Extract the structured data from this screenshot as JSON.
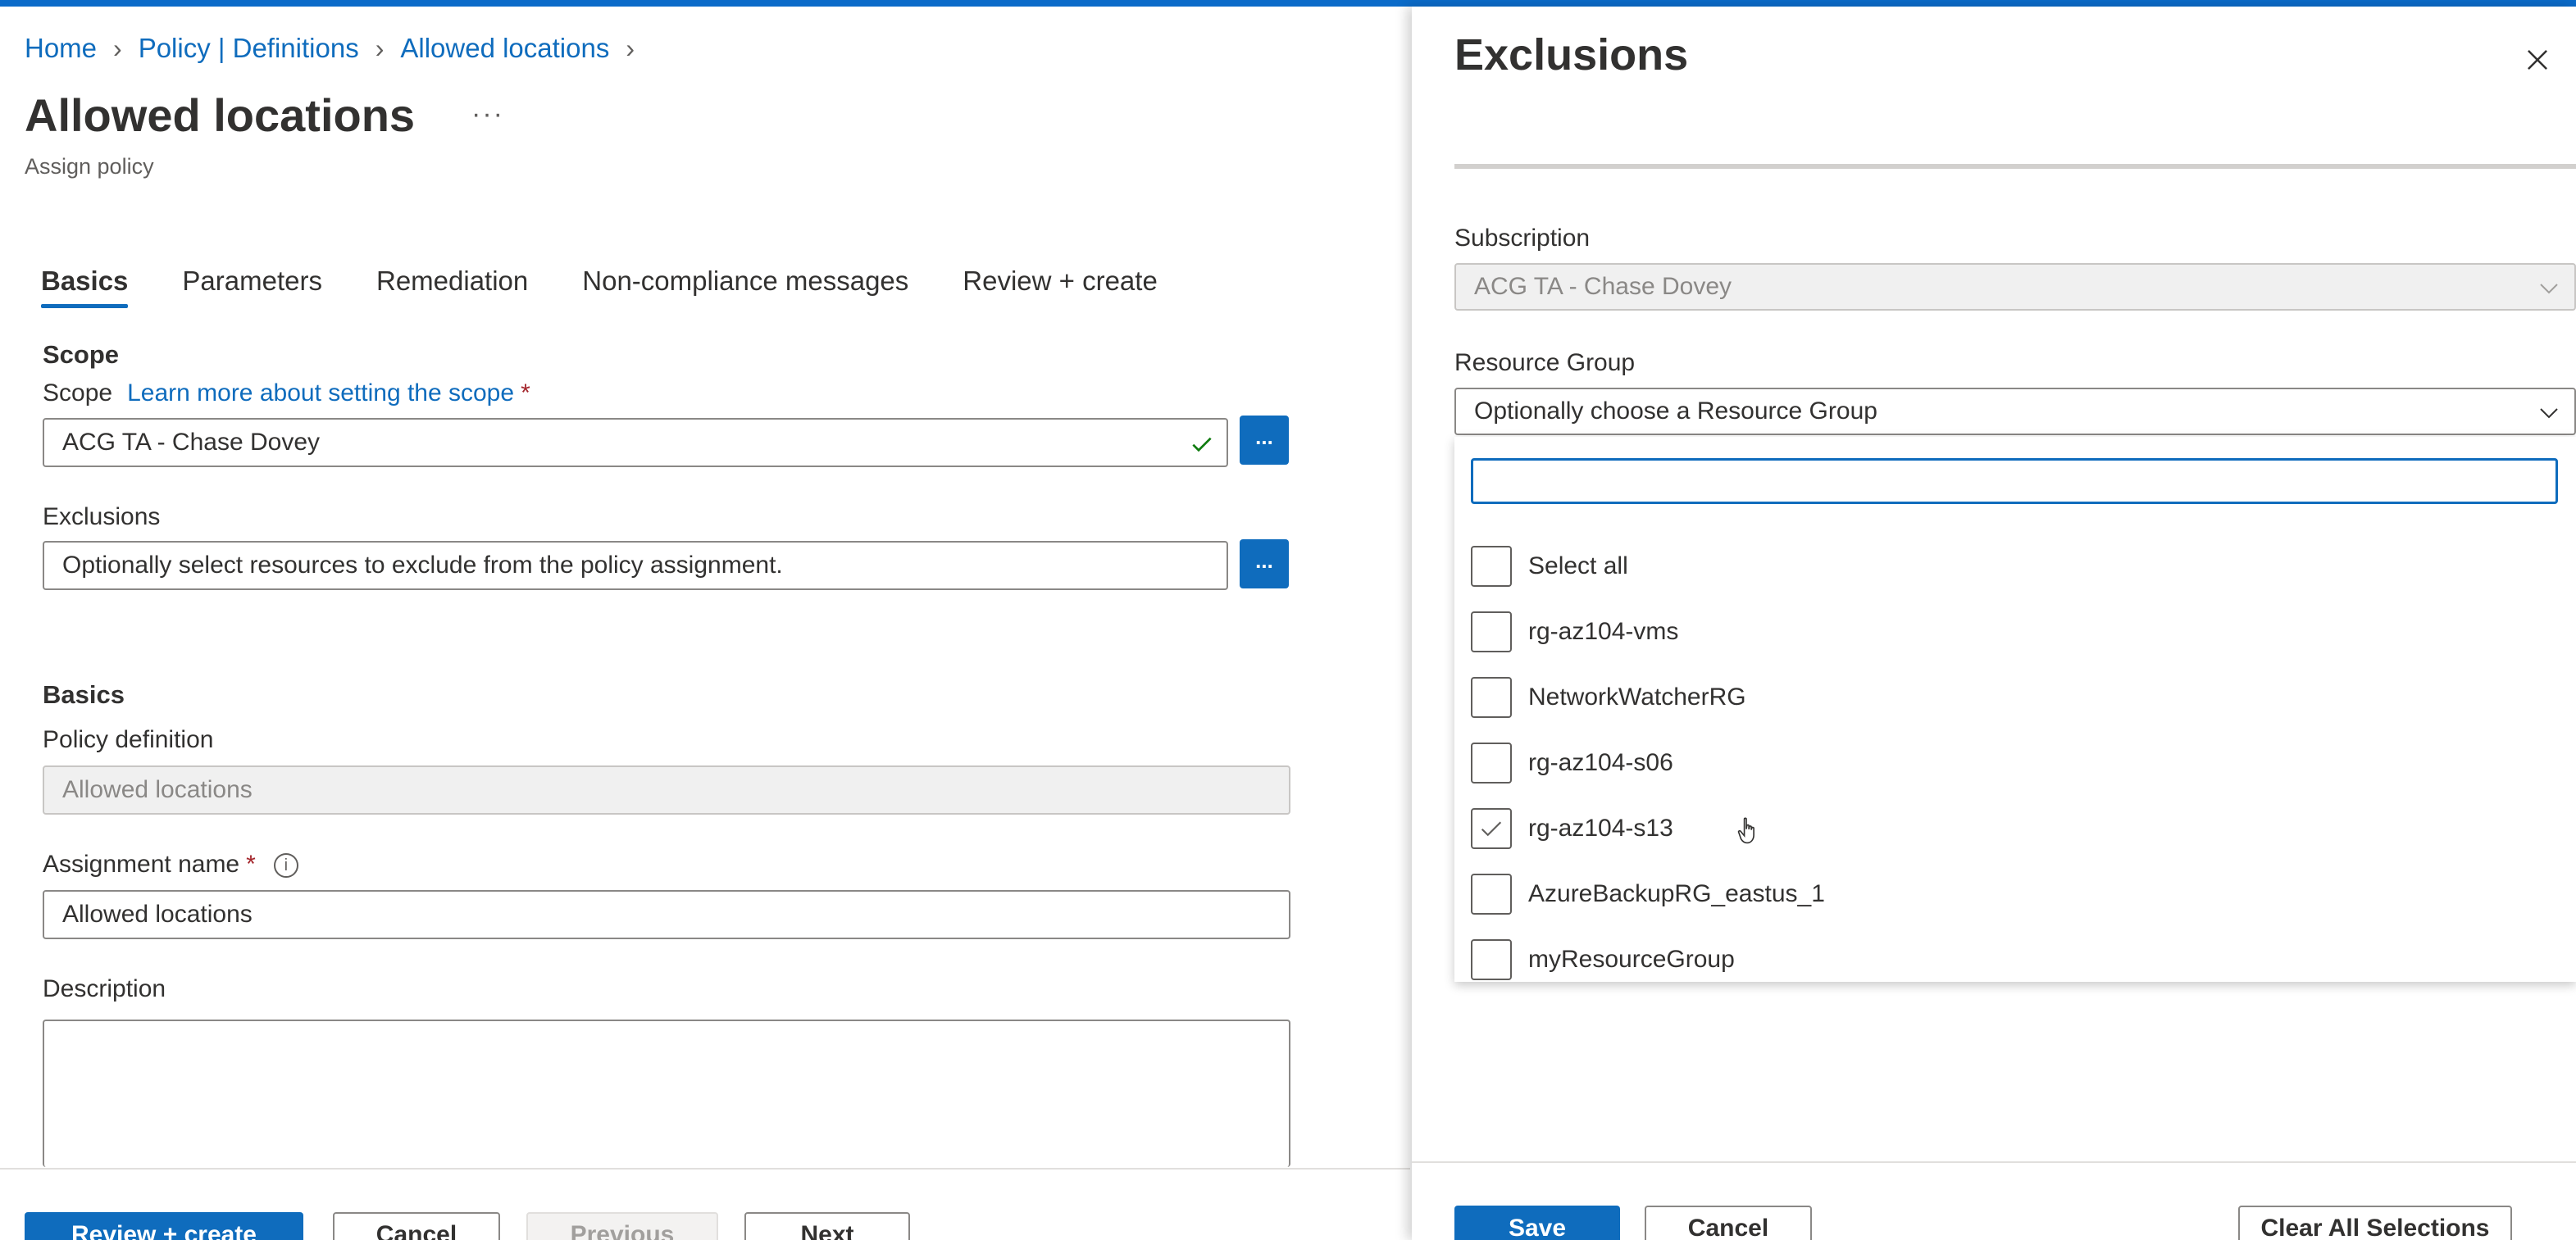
{
  "breadcrumb": [
    {
      "label": "Home"
    },
    {
      "label": "Policy | Definitions"
    },
    {
      "label": "Allowed locations"
    }
  ],
  "page": {
    "title": "Allowed locations",
    "more": "···",
    "subtitle": "Assign policy"
  },
  "tabs": [
    {
      "label": "Basics",
      "active": true
    },
    {
      "label": "Parameters"
    },
    {
      "label": "Remediation"
    },
    {
      "label": "Non-compliance messages"
    },
    {
      "label": "Review + create"
    }
  ],
  "scope": {
    "section_title": "Scope",
    "label": "Scope",
    "link": "Learn more about setting the scope",
    "required": "*",
    "value": "ACG TA - Chase Dovey",
    "button": "..."
  },
  "exclusions": {
    "label": "Exclusions",
    "placeholder": "Optionally select resources to exclude from the policy assignment.",
    "button": "..."
  },
  "basics": {
    "section_title": "Basics",
    "policy_definition_label": "Policy definition",
    "policy_definition_value": "Allowed locations",
    "assignment_name_label": "Assignment name",
    "required": "*",
    "info": "i",
    "assignment_name_value": "Allowed locations",
    "description_label": "Description"
  },
  "footer_left": {
    "review_create": "Review + create",
    "cancel": "Cancel",
    "previous": "Previous",
    "next": "Next"
  },
  "panel": {
    "title": "Exclusions",
    "subscription_label": "Subscription",
    "subscription_value": "ACG TA - Chase Dovey",
    "resource_group_label": "Resource Group",
    "resource_group_placeholder": "Optionally choose a Resource Group",
    "search_value": "",
    "items": [
      {
        "label": "Select all",
        "checked": false
      },
      {
        "label": "rg-az104-vms",
        "checked": false
      },
      {
        "label": "NetworkWatcherRG",
        "checked": false
      },
      {
        "label": "rg-az104-s06",
        "checked": false
      },
      {
        "label": "rg-az104-s13",
        "checked": true
      },
      {
        "label": "AzureBackupRG_eastus_1",
        "checked": false
      },
      {
        "label": "myResourceGroup",
        "checked": false
      }
    ]
  },
  "footer_right": {
    "save": "Save",
    "cancel": "Cancel",
    "clear_all": "Clear All Selections"
  },
  "colors": {
    "accent": "#0f6cbd",
    "success_check": "#107c10",
    "required": "#a4262c"
  }
}
